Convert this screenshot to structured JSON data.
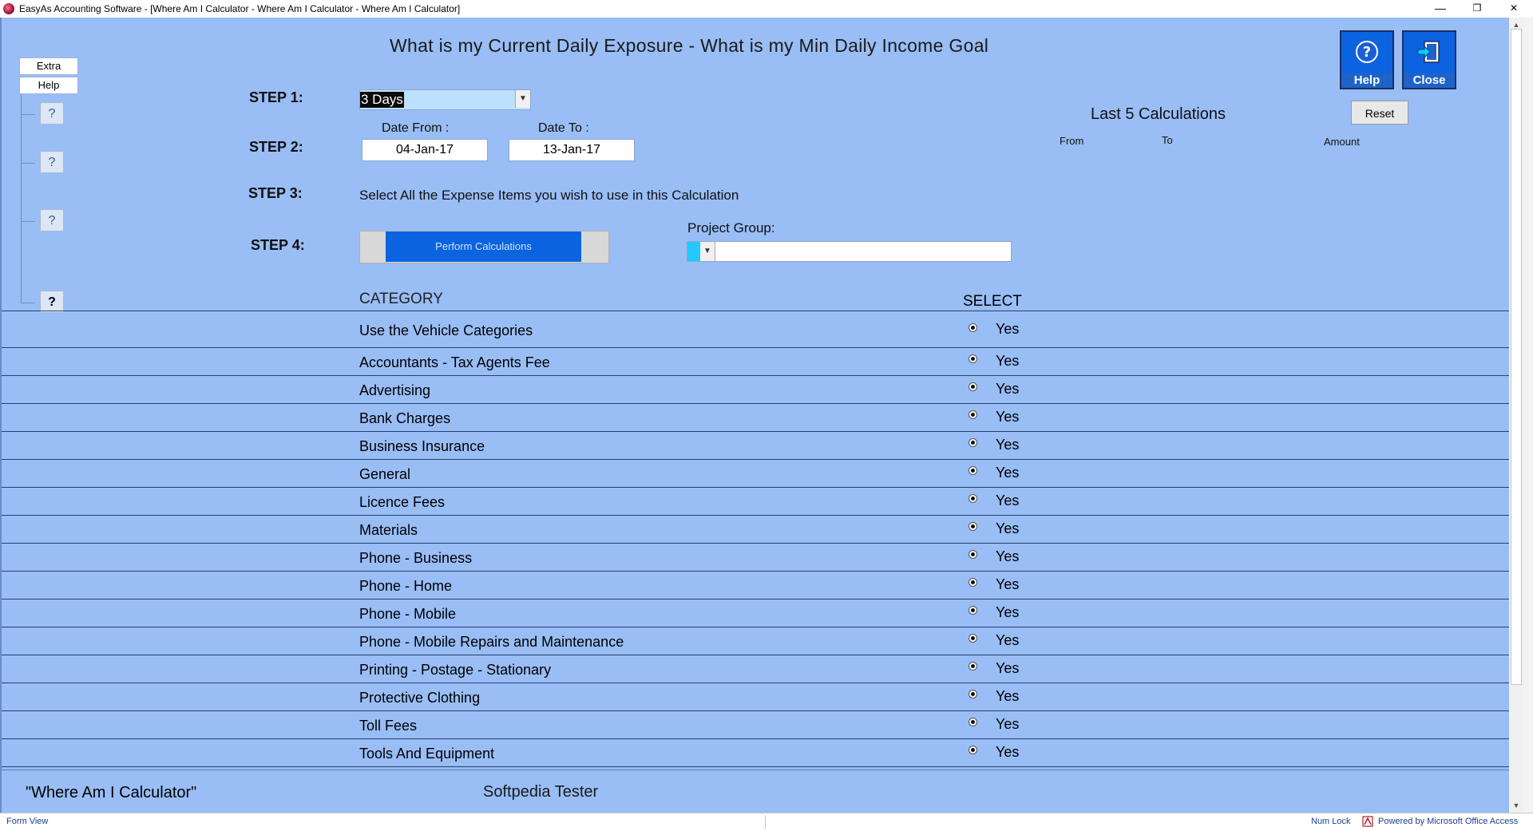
{
  "window": {
    "title": "EasyAs Accounting Software - [Where Am I Calculator  -  Where Am I Calculator  -  Where Am I Calculator]",
    "minimize": "—",
    "restore": "❐",
    "close": "✕"
  },
  "sidebar": {
    "extra_label": "Extra",
    "help_label": "Help",
    "question_buttons": [
      "?",
      "?",
      "?",
      "?"
    ]
  },
  "header": {
    "title": "What is my Current Daily Exposure  -   What is my Min Daily Income Goal",
    "help_button": "Help",
    "close_button": "Close"
  },
  "steps": {
    "step1_label": "STEP 1:",
    "step1_value": "3 Days",
    "step2_label": "STEP 2:",
    "date_from_label": "Date  From :",
    "date_to_label": "Date  To :",
    "date_from": "04-Jan-17",
    "date_to": "13-Jan-17",
    "step3_label": "STEP 3:",
    "step3_text": "Select All the Expense Items you wish to use in this Calculation",
    "step4_label": "STEP 4:",
    "perform_button": "Perform Calculations",
    "project_group_label": "Project Group:",
    "project_group_value": ""
  },
  "last_calculations": {
    "title": "Last 5 Calculations",
    "reset_button": "Reset",
    "col_from": "From",
    "col_to": "To",
    "col_amount": "Amount"
  },
  "table": {
    "col_category": "CATEGORY",
    "col_select": "SELECT",
    "rows": [
      {
        "category": "Use the  Vehicle Categories",
        "select": "Yes"
      },
      {
        "category": "Accountants - Tax Agents Fee",
        "select": "Yes"
      },
      {
        "category": "Advertising",
        "select": "Yes"
      },
      {
        "category": "Bank Charges",
        "select": "Yes"
      },
      {
        "category": "Business Insurance",
        "select": "Yes"
      },
      {
        "category": "General",
        "select": "Yes"
      },
      {
        "category": "Licence Fees",
        "select": "Yes"
      },
      {
        "category": "Materials",
        "select": "Yes"
      },
      {
        "category": "Phone - Business",
        "select": "Yes"
      },
      {
        "category": "Phone - Home",
        "select": "Yes"
      },
      {
        "category": "Phone - Mobile",
        "select": "Yes"
      },
      {
        "category": "Phone - Mobile Repairs and Maintenance",
        "select": "Yes"
      },
      {
        "category": "Printing - Postage - Stationary",
        "select": "Yes"
      },
      {
        "category": "Protective Clothing",
        "select": "Yes"
      },
      {
        "category": "Toll Fees",
        "select": "Yes"
      },
      {
        "category": "Tools And Equipment",
        "select": "Yes"
      }
    ]
  },
  "footer": {
    "form_name": "\"Where Am I  Calculator\"",
    "user": "Softpedia Tester"
  },
  "statusbar": {
    "view": "Form View",
    "numlock": "Num Lock",
    "powered": "Powered by Microsoft Office Access"
  },
  "colors": {
    "form_bg": "#99bdf5",
    "button_blue": "#0b63e0",
    "project_group_accent": "#21c9ff"
  }
}
